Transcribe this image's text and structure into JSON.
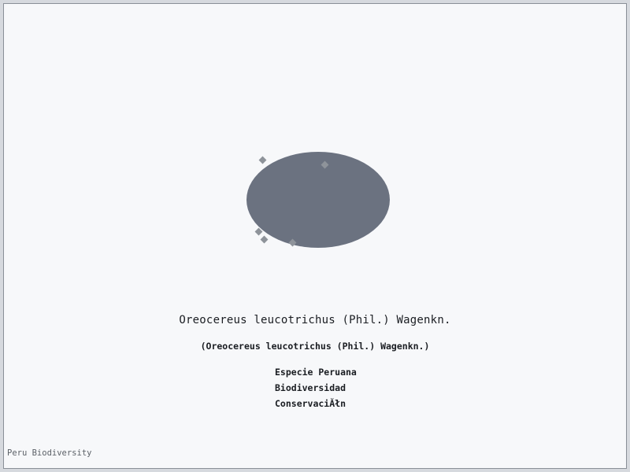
{
  "species": {
    "title": "Oreocereus leucotrichus (Phil.) Wagenkn.",
    "subtitle": "(Oreocereus leucotrichus (Phil.) Wagenkn.)"
  },
  "tags": [
    "Especie Peruana",
    "Biodiversidad",
    "ConservaciĂłn"
  ],
  "footer": {
    "brand": "Peru Biodiversity"
  },
  "colors": {
    "page_background": "#f7f8fa",
    "emblem_fill": "#6b7280",
    "emblem_markers": "#8e939a",
    "text": "#1a1d22",
    "border": "#d6d9de"
  },
  "icons": {
    "emblem": "species-placeholder-ellipse-icon"
  }
}
